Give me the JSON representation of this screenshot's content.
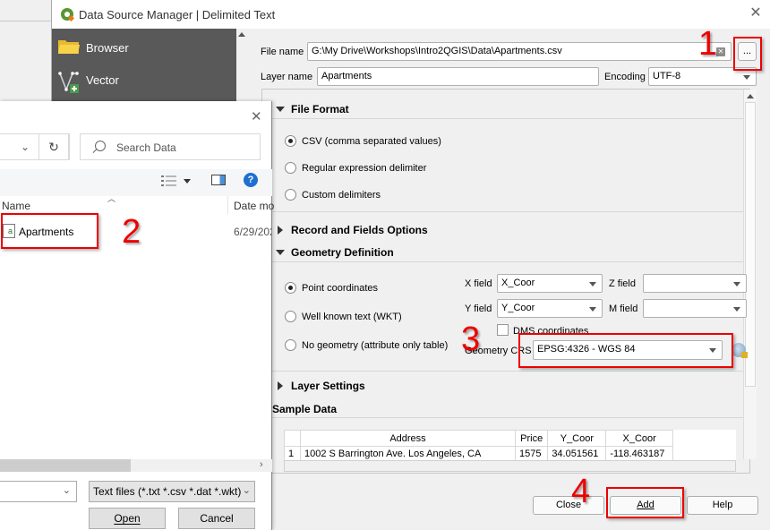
{
  "qgis_dialog": {
    "title": "Data Source Manager | Delimited Text",
    "sidebar": {
      "items": [
        {
          "label": "Browser",
          "icon": "folder-icon"
        },
        {
          "label": "Vector",
          "icon": "vector-add-icon"
        }
      ]
    },
    "file_name": {
      "label": "File name",
      "value": "G:\\My Drive\\Workshops\\Intro2QGIS\\Data\\Apartments.csv",
      "browse_label": "..."
    },
    "layer_name": {
      "label": "Layer name",
      "value": "Apartments"
    },
    "encoding": {
      "label": "Encoding",
      "value": "UTF-8"
    },
    "file_format": {
      "heading": "File Format",
      "options": [
        {
          "label": "CSV (comma separated values)",
          "checked": true
        },
        {
          "label": "Regular expression delimiter",
          "checked": false
        },
        {
          "label": "Custom delimiters",
          "checked": false
        }
      ]
    },
    "record_fields": {
      "heading": "Record and Fields Options"
    },
    "geometry": {
      "heading": "Geometry Definition",
      "options": [
        {
          "label": "Point coordinates",
          "checked": true
        },
        {
          "label": "Well known text (WKT)",
          "checked": false
        },
        {
          "label": "No geometry (attribute only table)",
          "checked": false
        }
      ],
      "x_field": {
        "label": "X field",
        "value": "X_Coor"
      },
      "y_field": {
        "label": "Y field",
        "value": "Y_Coor"
      },
      "z_field": {
        "label": "Z field",
        "value": ""
      },
      "m_field": {
        "label": "M field",
        "value": ""
      },
      "dms": {
        "label": "DMS coordinates",
        "checked": false
      },
      "crs": {
        "label": "Geometry CRS",
        "value": "EPSG:4326 - WGS 84"
      }
    },
    "layer_settings": {
      "heading": "Layer Settings"
    },
    "sample_data": {
      "heading": "Sample Data",
      "columns": [
        "Address",
        "Price",
        "Y_Coor",
        "X_Coor"
      ],
      "rows": [
        {
          "index": "1",
          "cells": [
            "1002 S Barrington Ave. Los Angeles, CA",
            "1575",
            "34.051561",
            "-118.463187"
          ]
        }
      ]
    },
    "buttons": {
      "close": "Close",
      "add": "Add",
      "help": "Help"
    }
  },
  "file_dialog": {
    "search_placeholder": "Search Data",
    "columns": {
      "name": "Name",
      "date": "Date mo"
    },
    "files": [
      {
        "name": "Apartments",
        "date": "6/29/202"
      }
    ],
    "file_type": "Text files (*.txt *.csv *.dat *.wkt)",
    "buttons": {
      "open": "Open",
      "cancel": "Cancel"
    }
  },
  "annotations": {
    "steps": [
      "1",
      "2",
      "3",
      "4"
    ],
    "color": "#e00000"
  }
}
